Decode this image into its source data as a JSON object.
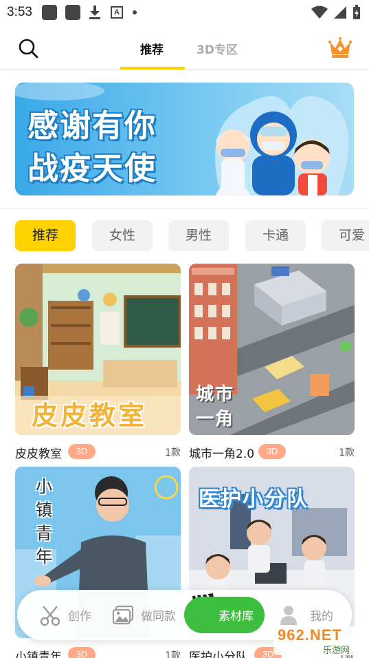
{
  "status_bar": {
    "time": "3:53"
  },
  "nav": {
    "tabs": [
      {
        "label": "推荐",
        "active": true
      },
      {
        "label": "3D专区",
        "active": false
      }
    ]
  },
  "banner": {
    "line1": "感谢有你",
    "line2": "战疫天使"
  },
  "categories": [
    "推荐",
    "女性",
    "男性",
    "卡通",
    "可爱"
  ],
  "cards": [
    {
      "title": "皮皮教室",
      "badge": "3D",
      "count": "1款",
      "art_text": "皮皮教室"
    },
    {
      "title": "城市一角2.0",
      "badge": "3D",
      "count": "1款",
      "art_text": "城市一角"
    },
    {
      "title": "小镇青年",
      "badge": "3D",
      "count": "1款",
      "art_text": "小镇青年"
    },
    {
      "title": "医护小分队",
      "badge": "3D",
      "count": "1款",
      "art_text": "医护小分队"
    }
  ],
  "bottom_bar": {
    "items": [
      {
        "label": "创作",
        "icon": "scissors-icon",
        "active": false
      },
      {
        "label": "做同款",
        "icon": "image-icon",
        "active": false
      },
      {
        "label": "素材库",
        "icon": "clapperboard-icon",
        "active": true
      },
      {
        "label": "我的",
        "icon": "person-icon",
        "active": false
      }
    ]
  },
  "watermark": {
    "brand": "962.NET",
    "sub": "乐游网"
  },
  "colors": {
    "accent_yellow": "#FFD100",
    "badge_orange": "#FFA989",
    "active_green": "#3DBE3E"
  }
}
